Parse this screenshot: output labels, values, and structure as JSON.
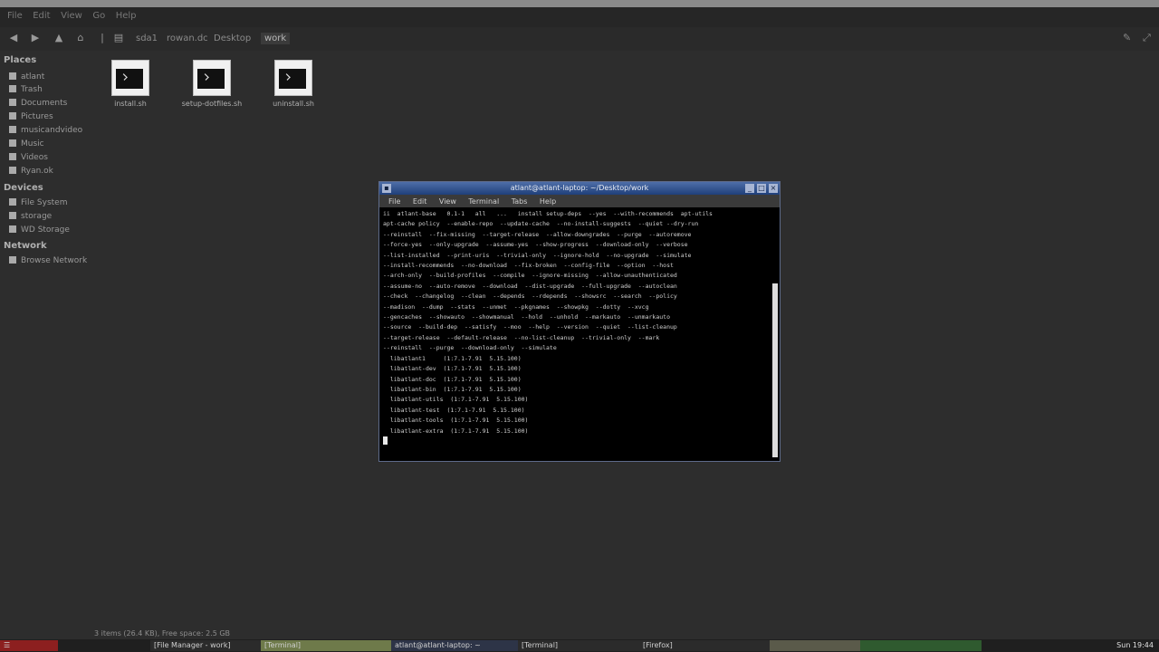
{
  "menubar": {
    "items": [
      "File",
      "Edit",
      "View",
      "Go",
      "Help"
    ]
  },
  "toolbar": {
    "breadcrumbs": [
      "sda1",
      "rowan.dc",
      "Desktop",
      "work"
    ],
    "active_breadcrumb": "work"
  },
  "sidebar": {
    "places_header": "Places",
    "places": [
      "atlant",
      "Trash",
      "Documents",
      "Pictures",
      "musicandvideo",
      "Music",
      "Videos",
      "Ryan.ok"
    ],
    "devices_header": "Devices",
    "devices": [
      "File System",
      "storage",
      "WD Storage"
    ],
    "network_header": "Network",
    "network": [
      "Browse Network"
    ]
  },
  "desktop_files": [
    {
      "name": "install.sh"
    },
    {
      "name": "setup-dotfiles.sh"
    },
    {
      "name": "uninstall.sh"
    }
  ],
  "terminal": {
    "title": "atlant@atlant-laptop: ~/Desktop/work",
    "menu": [
      "File",
      "Edit",
      "View",
      "Terminal",
      "Tabs",
      "Help"
    ],
    "lines": [
      "ii  atlant-base   0.1-1   all   ...   install setup-deps  --yes  --with-recommends  apt-utils",
      "apt-cache policy  --enable-repo  --update-cache  --no-install-suggests  --quiet --dry-run",
      "--reinstall  --fix-missing  --target-release  --allow-downgrades  --purge  --autoremove",
      "--force-yes  --only-upgrade  --assume-yes  --show-progress  --download-only  --verbose",
      "--list-installed  --print-uris  --trivial-only  --ignore-hold  --no-upgrade  --simulate",
      "--install-recommends  --no-download  --fix-broken  --config-file  --option  --host",
      "--arch-only  --build-profiles  --compile  --ignore-missing  --allow-unauthenticated",
      "--assume-no  --auto-remove  --download  --dist-upgrade  --full-upgrade  --autoclean",
      "--check  --changelog  --clean  --depends  --rdepends  --showsrc  --search  --policy",
      "--madison  --dump  --stats  --unmet  --pkgnames  --showpkg  --dotty  --xvcg",
      "--gencaches  --showauto  --showmanual  --hold  --unhold  --markauto  --unmarkauto",
      "--source  --build-dep  --satisfy  --moo  --help  --version  --quiet  --list-cleanup",
      "--target-release  --default-release  --no-list-cleanup  --trivial-only  --mark",
      "--reinstall  --purge  --download-only  --simulate",
      "  libatlant1     (1:7.1-7.91  5.15.100)",
      "  libatlant-dev  (1:7.1-7.91  5.15.100)",
      "  libatlant-doc  (1:7.1-7.91  5.15.100)",
      "  libatlant-bin  (1:7.1-7.91  5.15.100)",
      "  libatlant-utils  (1:7.1-7.91  5.15.100)",
      "  libatlant-test  (1:7.1-7.91  5.15.100)",
      "  libatlant-tools  (1:7.1-7.91  5.15.100)",
      "  libatlant-extra  (1:7.1-7.91  5.15.100)"
    ]
  },
  "statusbar": {
    "text": "3 items (26.4 KB), Free space: 2.5 GB"
  },
  "taskbar": {
    "items": [
      "[File Manager - work]",
      "[Terminal]",
      "atlant@atlant-laptop: ~",
      "[Terminal]",
      "[Firefox]"
    ],
    "clock": "Sun 19:44"
  },
  "colors": {
    "background": "#2d2d2d",
    "terminal_bg": "#000000",
    "title_gradient_top": "#4e6ea8",
    "title_gradient_bottom": "#1f3f7a"
  }
}
